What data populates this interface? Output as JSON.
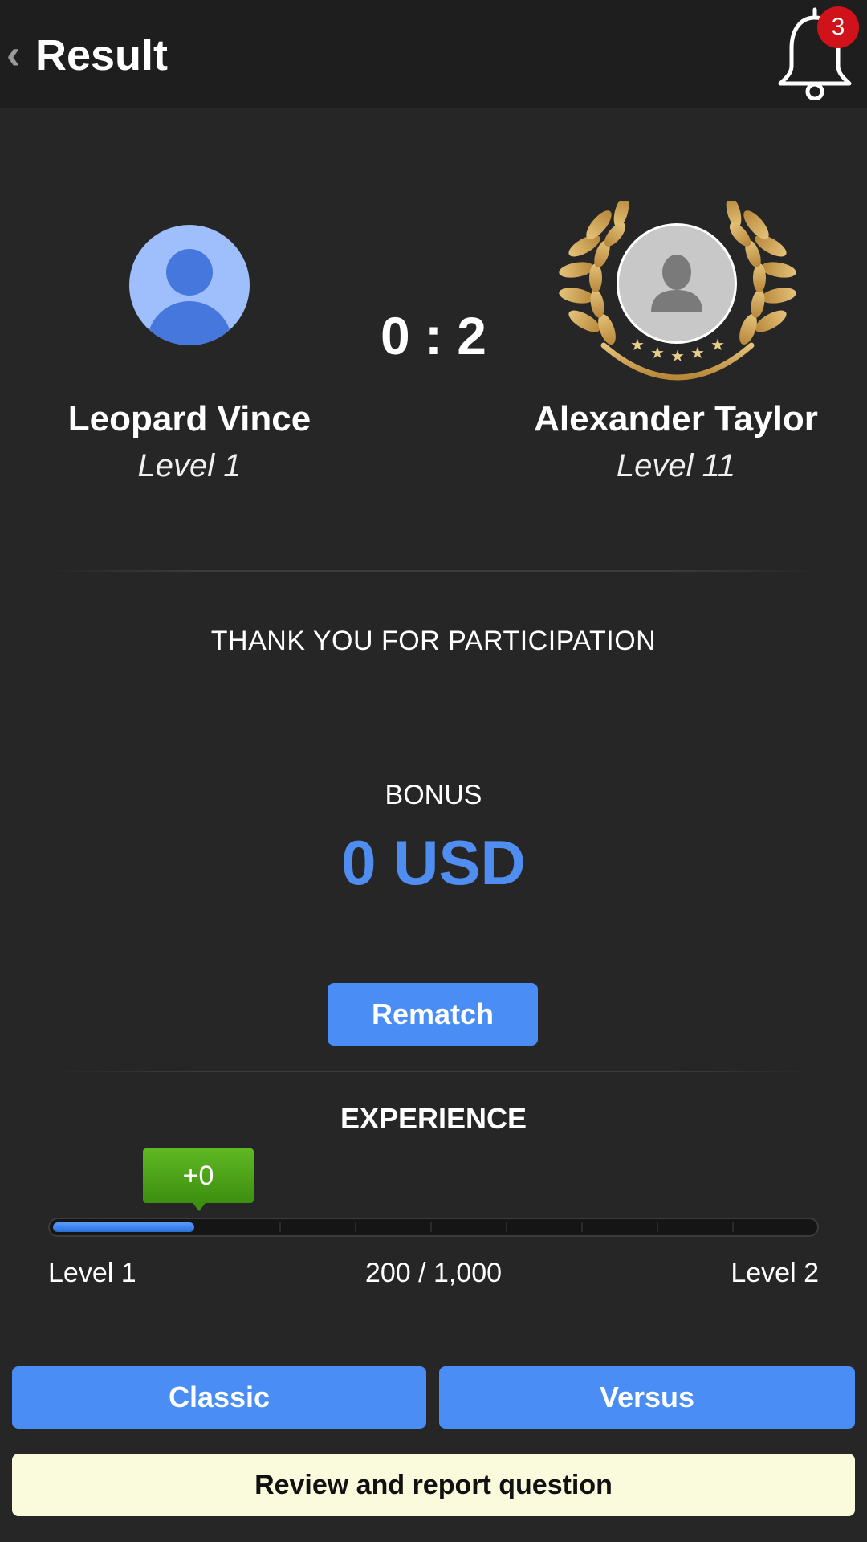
{
  "header": {
    "title": "Result",
    "back_icon": "chevron-left-icon",
    "notifications_icon": "bell-icon",
    "notifications_count": "3"
  },
  "match": {
    "score": "0 : 2",
    "player": {
      "name": "Leopard Vince",
      "level": "Level 1",
      "avatar_icon": "user-avatar-icon"
    },
    "opponent": {
      "name": "Alexander Taylor",
      "level": "Level 11",
      "avatar_icon": "default-avatar-icon",
      "badge_icon": "winner-laurel-icon"
    }
  },
  "result": {
    "message": "THANK YOU FOR PARTICIPATION",
    "bonus_label": "BONUS",
    "bonus_amount": "0 USD"
  },
  "actions": {
    "rematch_label": "Rematch",
    "classic_label": "Classic",
    "versus_label": "Versus",
    "review_label": "Review and report question"
  },
  "experience": {
    "title": "EXPERIENCE",
    "gain": "+0",
    "current_level": "Level 1",
    "next_level": "Level 2",
    "progress_text": "200 / 1,000",
    "progress_fraction": 0.2
  },
  "colors": {
    "accent": "#4a8ef5",
    "background": "#262626",
    "header": "#1e1e1e",
    "badge": "#d0121b",
    "gain_tag": "#4a9f17",
    "review_button": "#fafadc"
  }
}
